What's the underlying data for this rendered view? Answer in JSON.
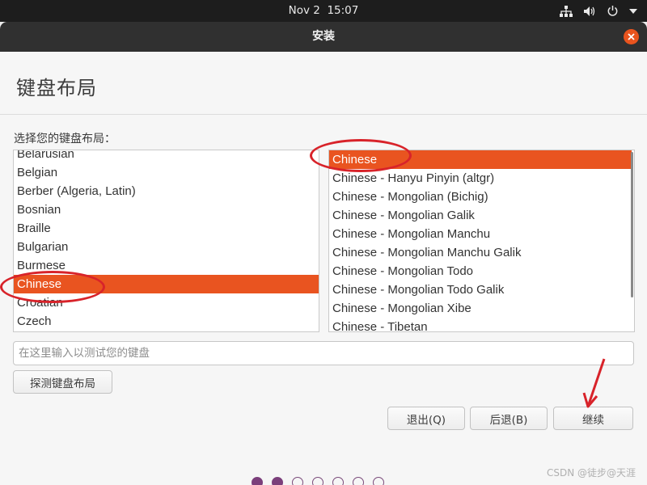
{
  "topbar": {
    "date": "Nov 2",
    "time": "15:07",
    "icons": [
      "network-icon",
      "volume-icon",
      "power-icon",
      "menu-down-icon"
    ]
  },
  "window": {
    "title": "安装",
    "close_icon": "close-icon"
  },
  "page": {
    "title": "键盘布局",
    "prompt": "选择您的键盘布局："
  },
  "layouts": {
    "items": [
      "Belarusian",
      "Belgian",
      "Berber (Algeria, Latin)",
      "Bosnian",
      "Braille",
      "Bulgarian",
      "Burmese",
      "Chinese",
      "Croatian",
      "Czech"
    ],
    "selected": "Chinese"
  },
  "variants": {
    "items": [
      "Chinese",
      "Chinese - Hanyu Pinyin (altgr)",
      "Chinese - Mongolian (Bichig)",
      "Chinese - Mongolian Galik",
      "Chinese - Mongolian Manchu",
      "Chinese - Mongolian Manchu Galik",
      "Chinese - Mongolian Todo",
      "Chinese - Mongolian Todo Galik",
      "Chinese - Mongolian Xibe",
      "Chinese - Tibetan"
    ],
    "selected": "Chinese"
  },
  "test_input": {
    "placeholder": "在这里输入以测试您的键盘",
    "value": ""
  },
  "buttons": {
    "detect": "探测键盘布局",
    "quit": "退出(Q)",
    "back": "后退(B)",
    "continue": "继续"
  },
  "progress": {
    "total_steps": 7,
    "completed_steps": 2
  },
  "watermark": "CSDN @徒步@天涯",
  "colors": {
    "accent": "#e95420",
    "annotation": "#d8232a",
    "progress_dot": "#7b3f7b"
  }
}
